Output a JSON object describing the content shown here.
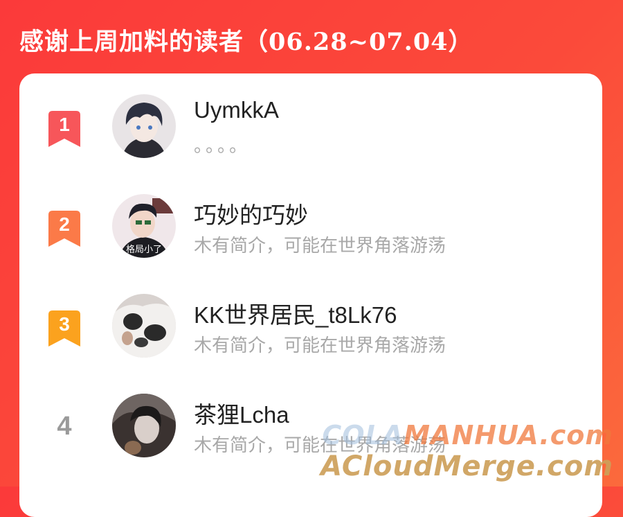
{
  "header": {
    "title": "感谢上周加料的读者",
    "date_range": "（06.28~07.04）"
  },
  "readers": [
    {
      "rank": "1",
      "name": "UymkkA",
      "bio": "。。。。",
      "avatar_caption": ""
    },
    {
      "rank": "2",
      "name": "巧妙的巧妙",
      "bio": "木有简介，可能在世界角落游荡",
      "avatar_caption": "格局小了"
    },
    {
      "rank": "3",
      "name": "KK世界居民_t8Lk76",
      "bio": "木有简介，可能在世界角落游荡",
      "avatar_caption": ""
    },
    {
      "rank": "4",
      "name": "茶狸Lcha",
      "bio": "木有简介，可能在世界角落游荡",
      "avatar_caption": ""
    }
  ],
  "rank_colors": {
    "1": "#f7565a",
    "2": "#fb7a48",
    "3": "#fba21e",
    "4": "#9a9a9a"
  },
  "watermark": {
    "line1_a": "COLA",
    "line1_b": "MANHUA.com",
    "line2": "ACloudMerge.com"
  }
}
